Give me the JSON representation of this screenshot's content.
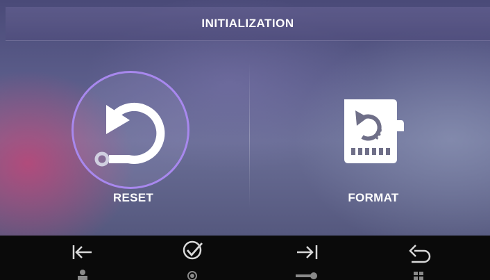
{
  "header": {
    "title": "INITIALIZATION"
  },
  "options": [
    {
      "label": "RESET",
      "icon": "reset-icon",
      "selected": true
    },
    {
      "label": "FORMAT",
      "icon": "sd-card-format-icon",
      "selected": false
    }
  ],
  "bottom_bar": {
    "buttons": [
      {
        "icon": "previous-icon",
        "secondary_icon": "person-icon"
      },
      {
        "icon": "confirm-check-icon",
        "secondary_icon": "record-icon"
      },
      {
        "icon": "next-icon",
        "secondary_icon": "key-icon"
      },
      {
        "icon": "back-icon",
        "secondary_icon": "menu-grid-icon"
      }
    ]
  },
  "colors": {
    "selection_ring": "#a888ee",
    "text": "#ffffff",
    "bottom_bar": "#0a0a0a"
  }
}
